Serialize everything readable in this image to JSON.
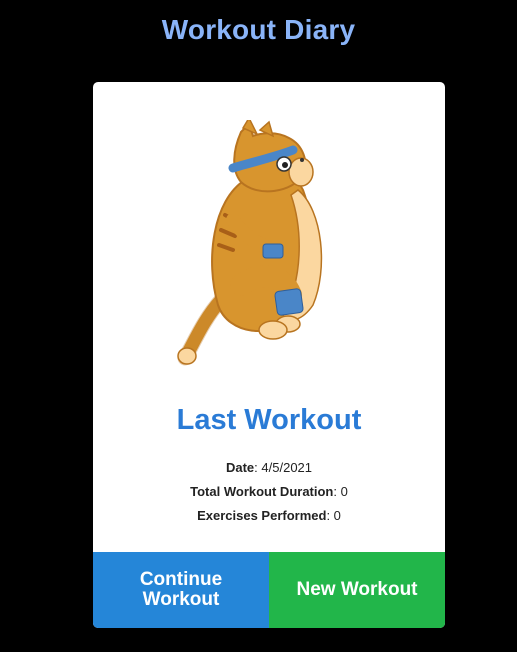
{
  "app": {
    "title": "Workout Diary"
  },
  "card": {
    "heading": "Last Workout",
    "stats": [
      {
        "label": "Date",
        "value": "4/5/2021"
      },
      {
        "label": "Total Workout Duration",
        "value": "0"
      },
      {
        "label": "Exercises Performed",
        "value": "0"
      }
    ],
    "buttons": {
      "continue_label": "Continue Workout",
      "new_label": "New Workout"
    },
    "illustration": "cat-exercising-icon"
  },
  "colors": {
    "background": "#000000",
    "title": "#8ab4f8",
    "heading": "#2a7bd6",
    "continue_button": "#2586d8",
    "new_button": "#22b64a"
  }
}
